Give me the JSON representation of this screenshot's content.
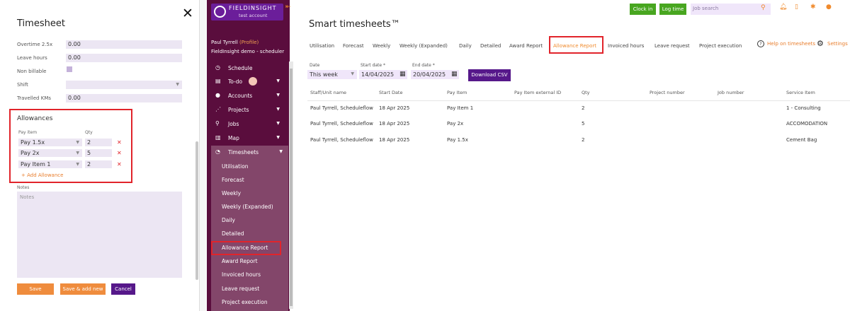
{
  "timesheet_panel": {
    "title": "Timesheet",
    "fields": [
      {
        "label": "Overtime 2.5x",
        "value": "0.00"
      },
      {
        "label": "Leave hours",
        "value": "0.00"
      },
      {
        "label": "Non billable",
        "value": ""
      },
      {
        "label": "Shift",
        "value": ""
      },
      {
        "label": "Travelled KMs",
        "value": "0.00"
      }
    ],
    "allowances": {
      "title": "Allowances",
      "col_pay_item": "Pay item",
      "col_qty": "Qty",
      "rows": [
        {
          "pay_item": "Pay 1.5x",
          "qty": "2"
        },
        {
          "pay_item": "Pay 2x",
          "qty": "5"
        },
        {
          "pay_item": "Pay Item 1",
          "qty": "2"
        }
      ],
      "add_label": "+ Add Allowance"
    },
    "notes_label": "Notes",
    "notes_placeholder": "Notes",
    "buttons": {
      "save": "Save",
      "save_add": "Save & add new",
      "cancel": "Cancel"
    }
  },
  "sidebar": {
    "brand": "FIELDINSIGHT",
    "brand_sub": "test account",
    "user_name": "Paul Tyrrell",
    "user_profile": "(Profile)",
    "company": "FieldInsight demo - scheduler",
    "items": [
      {
        "label": "Schedule",
        "icon": "calendar-icon"
      },
      {
        "label": "To-do",
        "icon": "clipboard-icon"
      },
      {
        "label": "Accounts",
        "icon": "person-icon"
      },
      {
        "label": "Projects",
        "icon": "nodes-icon"
      },
      {
        "label": "Jobs",
        "icon": "pin-icon"
      },
      {
        "label": "Map",
        "icon": "map-icon"
      },
      {
        "label": "Timesheets",
        "icon": "clock-icon"
      }
    ],
    "sub_items": [
      "Utilisation",
      "Forecast",
      "Weekly",
      "Weekly (Expanded)",
      "Daily",
      "Detailed",
      "Allowance Report",
      "Award Report",
      "Invoiced hours",
      "Leave request",
      "Project execution"
    ]
  },
  "topbar": {
    "clock_in": "Clock in",
    "log_time": "Log time",
    "search_placeholder": "Job search"
  },
  "main": {
    "title": "Smart timesheets™",
    "tabs": [
      "Utilisation",
      "Forecast",
      "Weekly",
      "Weekly (Expanded)",
      "Daily",
      "Detailed",
      "Award Report",
      "Allowance Report",
      "Invoiced hours",
      "Leave request",
      "Project execution"
    ],
    "help": "Help on timesheets",
    "settings": "Settings",
    "filters": {
      "date_label": "Date",
      "date_value": "This week",
      "start_label": "Start date *",
      "start_value": "14/04/2025",
      "end_label": "End date *",
      "end_value": "20/04/2025",
      "download": "Download CSV"
    },
    "table": {
      "headers": [
        "Staff/Unit name",
        "Start Date",
        "Pay Item",
        "Pay Item external ID",
        "Qty",
        "Project number",
        "Job number",
        "Service Item"
      ],
      "rows": [
        [
          "Paul Tyrrell, Scheduleflow",
          "18 Apr 2025",
          "Pay Item 1",
          "",
          "2",
          "",
          "",
          "1 - Consulting"
        ],
        [
          "Paul Tyrrell, Scheduleflow",
          "18 Apr 2025",
          "Pay 2x",
          "",
          "5",
          "",
          "",
          "ACCOMODATION"
        ],
        [
          "Paul Tyrrell, Scheduleflow",
          "18 Apr 2025",
          "Pay 1.5x",
          "",
          "2",
          "",
          "",
          "Cement Bag"
        ]
      ]
    }
  },
  "colors": {
    "orange": "#f08a2c",
    "purple": "#56188a",
    "sidebar": "#5a0d3d",
    "green": "#48a620",
    "highlight": "#e1242b"
  }
}
